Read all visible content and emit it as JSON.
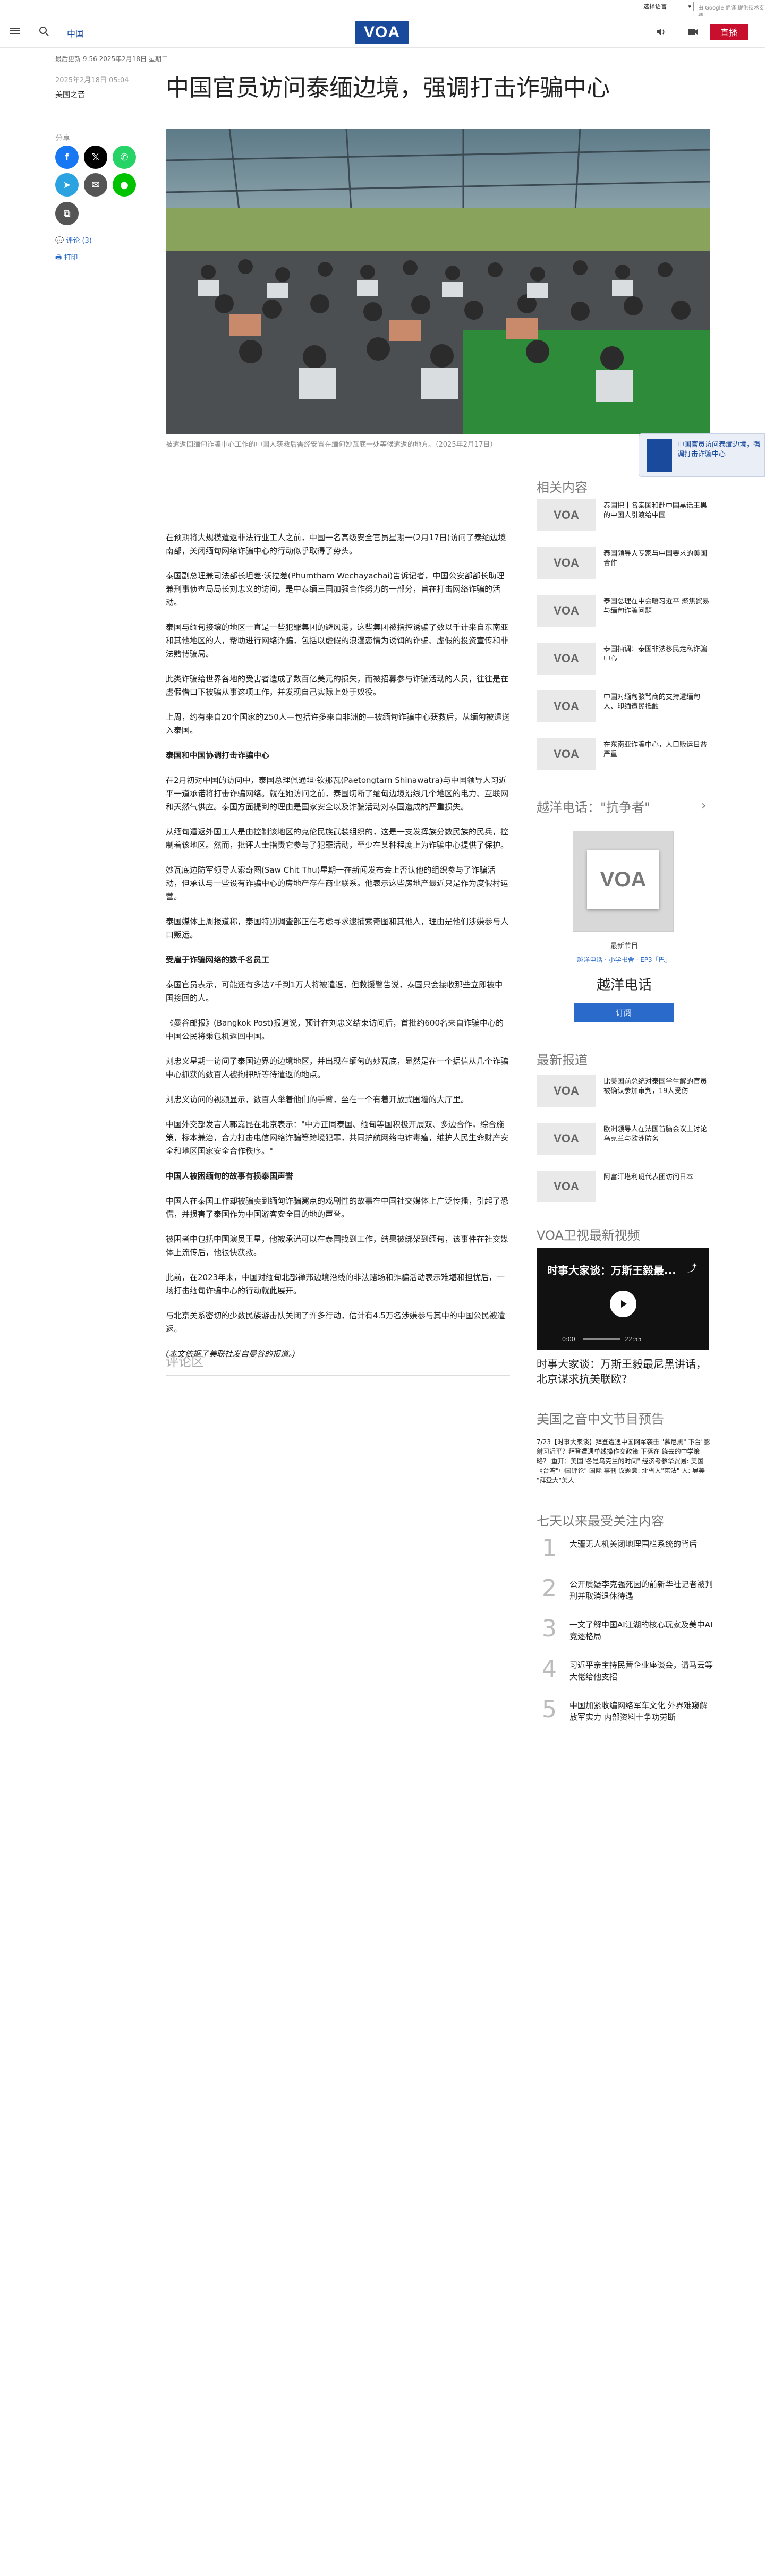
{
  "translate": {
    "select": "选择语言",
    "powered": "由 Google 翻译 提供技术支持"
  },
  "header": {
    "nav_link": "中国",
    "logo": "VOA",
    "live": "直播"
  },
  "meta": {
    "updated": "最后更新 9:56 2025年2月18日 星期二",
    "published": "2025年2月18日 05:04",
    "byline": "美国之音"
  },
  "title": "中国官员访问泰缅边境，强调打击诈骗中心",
  "share": {
    "label": "分享",
    "comments": "评论 (3)",
    "print": "打印"
  },
  "photo_caption": "被遣返回缅甸诈骗中心工作的中国人获救后需经安置在缅甸妙瓦底一处等候遣返的地方。（2025年2月17日）",
  "float_card": {
    "text": "中国官员访问泰缅边境，强调打击诈骗中心"
  },
  "article": {
    "p1": "在预期将大规模遣返非法行业工人之前，中国一名高级安全官员星期一(2月17日)访问了泰缅边境南部，关闭缅甸网络诈骗中心的行动似乎取得了势头。",
    "p2": "泰国副总理兼司法部长坦差·沃拉差(Phumtham Wechayachai)告诉记者，中国公安部部长助理兼刑事侦查局局长刘忠义的访问，是中泰缅三国加强合作努力的一部分，旨在打击网络诈骗的活动。",
    "p3": "泰国与缅甸接壤的地区一直是一些犯罪集团的避风港，这些集团被指控诱骗了数以千计来自东南亚和其他地区的人，帮助进行网络诈骗，包括以虚假的浪漫恋情为诱饵的诈骗、虚假的投资宣传和非法赌博骗局。",
    "p4": "此类诈骗给世界各地的受害者造成了数百亿美元的损失，而被招募参与诈骗活动的人员，往往是在虚假借口下被骗从事这项工作，并发现自己实际上处于奴役。",
    "p5": "上周，约有来自20个国家的250人—包括许多来自非洲的—被缅甸诈骗中心获救后，从缅甸被遣送入泰国。",
    "h1": "泰国和中国协调打击诈骗中心",
    "p6": "在2月初对中国的访问中，泰国总理佩通坦·钦那瓦(Paetongtarn Shinawatra)与中国领导人习近平一道承诺将打击诈骗网络。就在她访问之前，泰国切断了缅甸边境沿线几个地区的电力、互联网和天然气供应。泰国方面提到的理由是国家安全以及诈骗活动对泰国造成的严重损失。",
    "p7": "从缅甸遣返外国工人是由控制该地区的克伦民族武装组织的，这是一支发挥族分数民族的民兵，控制着该地区。然而，批评人士指责它参与了犯罪活动，至少在某种程度上为诈骗中心提供了保护。",
    "p8": "妙瓦底边防军领导人索奇图(Saw Chit Thu)星期一在新闻发布会上否认他的组织参与了诈骗活动，但承认与一些设有诈骗中心的房地产存在商业联系。他表示这些房地产最近只是作为度假村运营。",
    "p9": "泰国媒体上周报道称，泰国特别调查部正在考虑寻求逮捕索奇图和其他人，理由是他们涉嫌参与人口贩运。",
    "h2": "受雇于诈骗网络的数千名员工",
    "p10": "泰国官员表示，可能还有多达7千到1万人将被遣返，但救援警告说，泰国只会接收那些立即被中国接回的人。",
    "p11": "《曼谷邮报》(Bangkok Post)报道说，预计在刘忠义结束访问后，首批约600名来自诈骗中心的中国公民将乘包机返回中国。",
    "p12": "刘忠义星期一访问了泰国边界的边境地区，并出现在缅甸的妙瓦底，显然是在一个据信从几个诈骗中心抓获的数百人被拘押所等待遣返的地点。",
    "p13": "刘忠义访问的视频显示，数百人举着他们的手臂，坐在一个有着开放式围墙的大厅里。",
    "p14": "中国外交部发言人郭嘉昆在北京表示：\"中方正同泰国、缅甸等国积极开展双、多边合作，综合施策，标本兼治，合力打击电信网络诈骗等跨境犯罪，共同护航网络电诈毒瘤，维护人民生命财产安全和地区国家安全合作秩序。\"",
    "h3": "中国人被困缅甸的故事有损泰国声誉",
    "p15": "中国人在泰国工作却被骗卖到缅甸诈骗窝点的戏剧性的故事在中国社交媒体上广泛传播，引起了恐慌，并损害了泰国作为中国游客安全目的地的声誉。",
    "p16": "被困者中包括中国演员王星，他被承诺可以在泰国找到工作，结果被绑架到缅甸，该事件在社交媒体上流传后，他很快获救。",
    "p17": "此前，在2023年末，中国对缅甸北部禅邦边境沿线的非法赌场和诈骗活动表示难堪和担忧后，一场打击缅甸诈骗中心的行动就此展开。",
    "p18": "与北京关系密切的少数民族游击队关闭了许多行动，估计有4.5万名涉嫌参与其中的中国公民被遣返。",
    "source": "(本文依据了美联社发自曼谷的报道。)",
    "comments_heading": "评论区"
  },
  "sidebar": {
    "related_heading": "相关内容",
    "related": [
      "泰国把十名泰国和赴中国黑话王黑的中国人引渡给中国",
      "泰国领导人专家与中国要求的美国合作",
      "泰国总理在中会晤习近平 聚焦贸易与缅甸诈骗问题",
      "泰国抽调：泰国非法移民走私诈骗中心",
      "中国对缅甸骇骂商的支持遭缅甸人、印缅遭民抵触",
      "在东南亚诈骗中心，人口贩运日益严重"
    ],
    "podcast_heading": "越洋电话：\"抗争者\"",
    "podcast_logo": "VOA",
    "podcast_sub": "最新节目",
    "podcast_links": "越洋电话 · 小学书舍 · EP3「巴」",
    "podcast_title": "越洋电话",
    "podcast_subscribe": "订阅",
    "news_heading": "最新报道",
    "news": [
      "比美国前总统对泰国学生解的官员被确认参加审判，19人受伤",
      "欧洲领导人在法国首脑会议上讨论乌克兰与欧洲防务",
      "阿富汗塔利班代表团访问日本"
    ],
    "video_heading": "VOA卫视最新视频",
    "video_title": "时事大家谈：万斯王毅最...",
    "video_time_start": "0:00",
    "video_time_end": "22:55",
    "video_caption": "时事大家谈：万斯王毅最尼黑讲话，北京谋求抗美联欧?",
    "schedule_heading": "美国之音中文节目预告",
    "schedule_text": "7/23【时事大家谈】拜登遭遇中国网军袭击 \"慕尼黑\"\n下台\"影射习近平？拜登遭遇单线操作交政策 下落在\n绕去的中学策略？ 重开：美国\"各是乌克兰的时间\"\n经济考参华贸易: 美国《台湾\"中国评论\" 国际\n事刊 议题意: 北省人\"宪法\" 人: 吴美 \"拜登大\"美人",
    "popular_heading": "七天以来最受关注内容",
    "popular": [
      {
        "num": "1",
        "text": "大疆无人机关闭地理围栏系统的背后"
      },
      {
        "num": "2",
        "text": "公开质疑李克强死因的前新华社记者被判刑并取消退休待遇"
      },
      {
        "num": "3",
        "text": "一文了解中国AI江湖的核心玩家及美中AI竞逐格局"
      },
      {
        "num": "4",
        "text": "习近平亲主持民营企业座谈会，请马云等大佬给他支招"
      },
      {
        "num": "5",
        "text": "中国加紧收编网络军车文化 外界难窥解放军实力 内部资料十争功劳断"
      }
    ]
  },
  "colors": {
    "brand": "#1a4a9c",
    "live": "#c8102e",
    "link": "#2a6acb"
  }
}
